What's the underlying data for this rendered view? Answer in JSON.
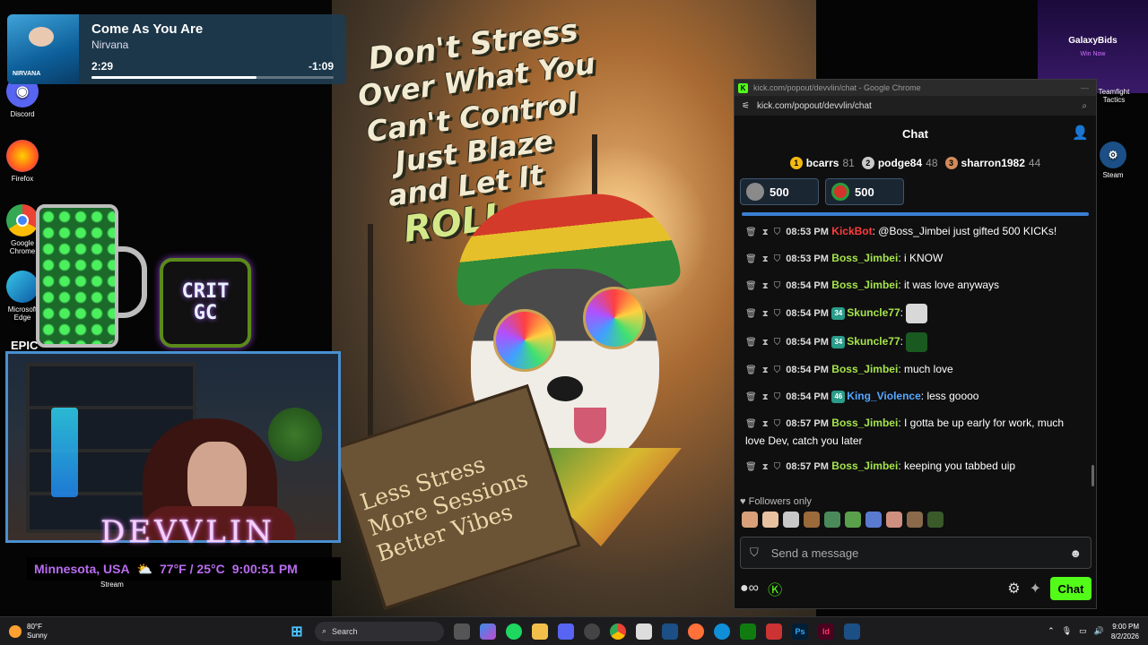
{
  "desktop": {
    "left_icons": [
      {
        "label": "Discord",
        "color": "#5865f2",
        "glyph": "◉"
      },
      {
        "label": "Firefox",
        "color": "#ff7139",
        "glyph": "●"
      },
      {
        "label": "Google Chrome",
        "color": "#1a73e8",
        "glyph": "◎"
      },
      {
        "label": "Microsoft Edge",
        "color": "#0f8fd8",
        "glyph": "◐"
      }
    ],
    "epic_label": "EPIC",
    "right_icons": [
      {
        "label": "Teamfight Tactics"
      },
      {
        "label": "Steam"
      }
    ],
    "galaxy": {
      "name": "GalaxyBids",
      "cta": "Win Now"
    }
  },
  "media": {
    "title": "Come As You Are",
    "artist": "Nirvana",
    "elapsed": "2:29",
    "remaining": "-1:09",
    "progress": 0.68,
    "album_tag": "NIRVANA"
  },
  "poster": {
    "headline": [
      "Don't Stress",
      "Over What You",
      "Can't Control",
      "Just Blaze",
      "and Let It",
      "ROLL"
    ],
    "sign": [
      "Less Stress",
      "More Sessions",
      "Better Vibes"
    ]
  },
  "overlay": {
    "crit_line1": "CRIT",
    "crit_line2": "GC",
    "streamer": "DEVVLIN",
    "location": "Minnesota, USA",
    "temperature": "77°F / 25°C",
    "time": "9:00:51 PM",
    "stream_label": "Stream"
  },
  "browser": {
    "title": "kick.com/popout/devvlin/chat - Google Chrome",
    "url": "kick.com/popout/devvlin/chat",
    "favicon": "K"
  },
  "chat": {
    "header": "Chat",
    "leaders": [
      {
        "rank": "1",
        "name": "bcarrs",
        "points": "81",
        "color": "#f2b90f"
      },
      {
        "rank": "2",
        "name": "podge84",
        "points": "48",
        "color": "#c9c9c9"
      },
      {
        "rank": "3",
        "name": "sharron1982",
        "points": "44",
        "color": "#d38a5a"
      }
    ],
    "pins": [
      {
        "amount": "500"
      },
      {
        "amount": "500"
      }
    ],
    "messages": [
      {
        "time": "08:53 PM",
        "user": "KickBot",
        "user_color": "#ff3b3b",
        "badge": "",
        "text": "@Boss_Jimbei just gifted 500 KICKs!"
      },
      {
        "time": "08:53 PM",
        "user": "Boss_Jimbei",
        "user_color": "#a5e34b",
        "badge": "",
        "text": "i KNOW"
      },
      {
        "time": "08:54 PM",
        "user": "Boss_Jimbei",
        "user_color": "#a5e34b",
        "badge": "",
        "text": "it was love anyways"
      },
      {
        "time": "08:54 PM",
        "user": "Skuncle77",
        "user_color": "#a5e34b",
        "badge": "34",
        "text": ""
      },
      {
        "time": "08:54 PM",
        "user": "Skuncle77",
        "user_color": "#a5e34b",
        "badge": "34",
        "text": ""
      },
      {
        "time": "08:54 PM",
        "user": "Boss_Jimbei",
        "user_color": "#a5e34b",
        "badge": "",
        "text": "much love"
      },
      {
        "time": "08:54 PM",
        "user": "King_Violence",
        "user_color": "#55a8ff",
        "badge": "46",
        "text": "less goooo"
      },
      {
        "time": "08:57 PM",
        "user": "Boss_Jimbei",
        "user_color": "#a5e34b",
        "badge": "",
        "text": "I gotta be up early for work, much love Dev, catch you later"
      },
      {
        "time": "08:57 PM",
        "user": "Boss_Jimbei",
        "user_color": "#a5e34b",
        "badge": "",
        "text": "keeping you tabbed uip"
      }
    ],
    "followers_only": "Followers only",
    "input_placeholder": "Send a message",
    "send_label": "Chat"
  },
  "taskbar": {
    "temp": "80°F",
    "condition": "Sunny",
    "search_placeholder": "Search",
    "clock_time": "9:00 PM",
    "clock_date": "8/2/2026"
  }
}
